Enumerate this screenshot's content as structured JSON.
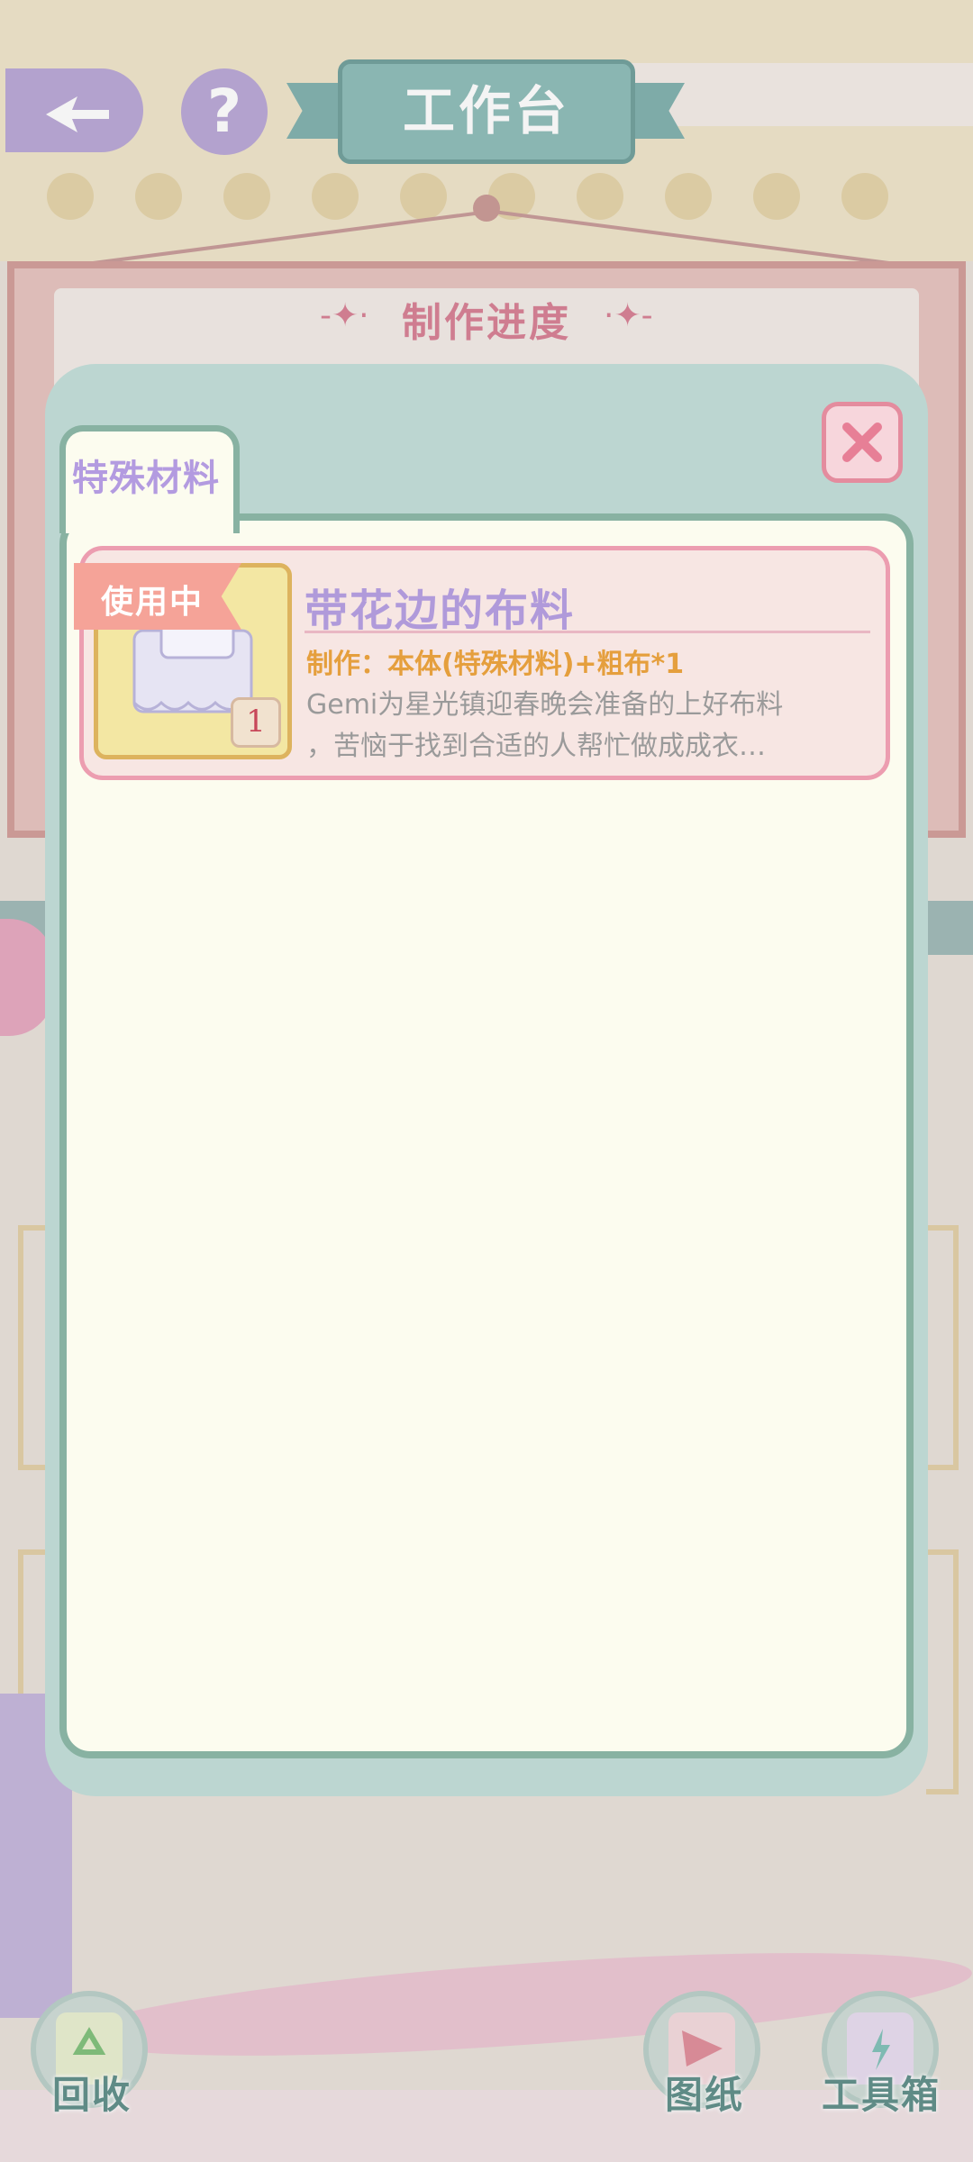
{
  "header": {
    "title": "工作台",
    "help_glyph": "?",
    "back_icon": "back-arrow-icon"
  },
  "board": {
    "progress_title": "制作进度",
    "ornament_left": "-✦·",
    "ornament_right": "·✦-"
  },
  "modal": {
    "tab_label": "特殊材料",
    "close_icon": "close-icon",
    "items": [
      {
        "status_label": "使用中",
        "name": "带花边的布料",
        "recipe": "制作：本体(特殊材料)+粗布*1",
        "description_line1": "Gemi为星光镇迎春晚会准备的上好布料",
        "description_line2": "，苦恼于找到合适的人帮忙做成成衣…",
        "quantity": "1"
      }
    ]
  },
  "bottom_bar": {
    "recycle_label": "回收",
    "blueprint_label": "图纸",
    "toolbox_label": "工具箱"
  },
  "colors": {
    "modal_bg": "#bcd6d1",
    "panel_bg": "#fcfcef",
    "accent_purple": "#b09ada",
    "accent_pink": "#ec9db0",
    "recipe_orange": "#e59f3d"
  }
}
